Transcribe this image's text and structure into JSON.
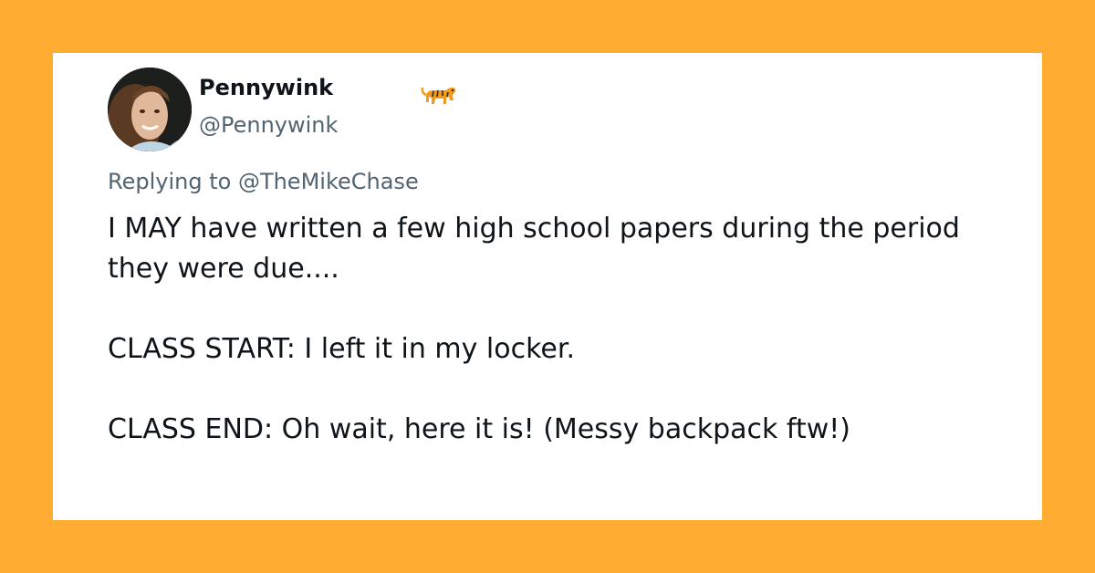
{
  "tweet": {
    "author": {
      "name": "Pennywink",
      "handle": "@Pennywink",
      "emoji_icon": "tiger-icon"
    },
    "reply_prefix": "Replying to ",
    "reply_to": "@TheMikeChase",
    "paragraphs": [
      "I MAY have written a few high school papers during the period they were due....",
      "CLASS START: I left it in my locker.",
      "CLASS END: Oh wait, here it is! (Messy backpack ftw!)"
    ]
  },
  "colors": {
    "background": "#FFAC33",
    "card": "#FFFFFF",
    "text": "#0F1419",
    "muted": "#536471"
  }
}
